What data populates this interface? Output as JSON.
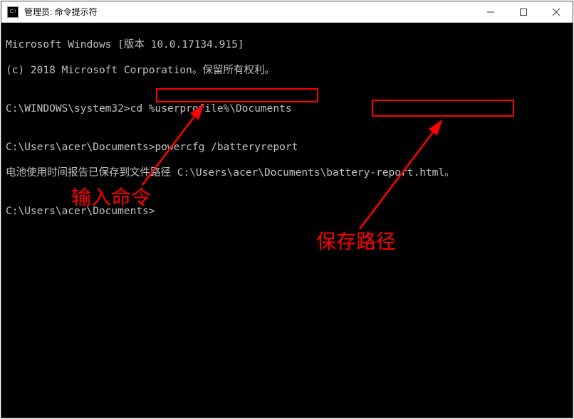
{
  "window": {
    "title": "管理员: 命令提示符",
    "icon_text": "C:\\"
  },
  "terminal": {
    "line1": "Microsoft Windows [版本 10.0.17134.915]",
    "line2": "(c) 2018 Microsoft Corporation。保留所有权利。",
    "line3": "",
    "line4_prompt": "C:\\WINDOWS\\system32>",
    "line4_cmd": "cd %userprofile%\\Documents",
    "line5": "",
    "line6_prompt": "C:\\Users\\acer\\Documents>",
    "line6_cmd": "powercfg /batteryreport",
    "line7_a": "电池使用时间报告已保存到文件路径 C:\\Users\\acer\\Documents\\",
    "line7_b": "battery-report.html",
    "line7_c": "。",
    "line8": "",
    "line9_prompt": "C:\\Users\\acer\\Documents>",
    "line9_cmd": ""
  },
  "annotations": {
    "label1": "输入命令",
    "label2": "保存路径"
  }
}
